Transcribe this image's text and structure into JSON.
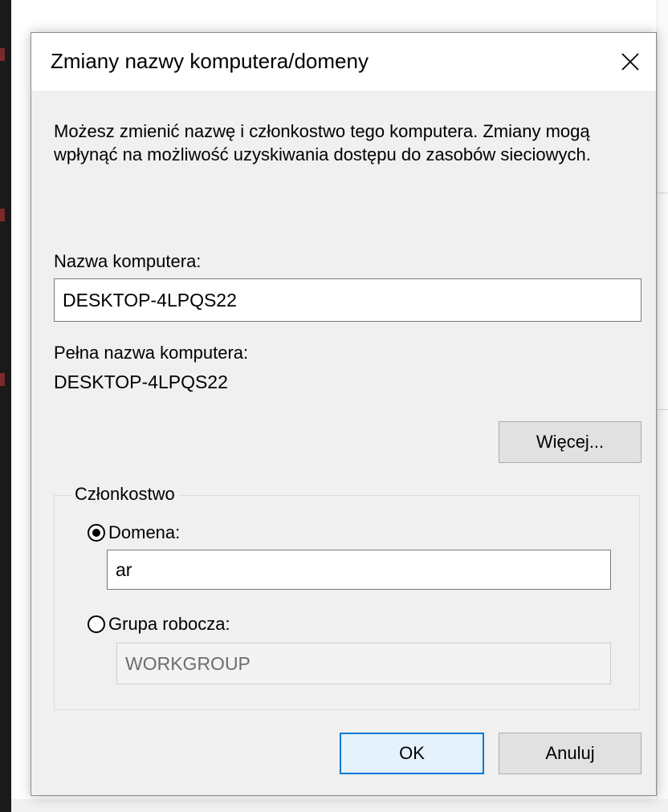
{
  "dialog": {
    "title": "Zmiany nazwy komputera/domeny",
    "description": "Możesz zmienić nazwę i członkostwo tego komputera. Zmiany mogą wpłynąć na możliwość uzyskiwania dostępu do zasobów sieciowych.",
    "computer_name_label": "Nazwa komputera:",
    "computer_name_value": "DESKTOP-4LPQS22",
    "full_name_label": "Pełna nazwa komputera:",
    "full_name_value": "DESKTOP-4LPQS22",
    "more_button": "Więcej...",
    "membership": {
      "group_label": "Członkostwo",
      "domain_label": "Domena:",
      "domain_value": "ar",
      "domain_selected": true,
      "workgroup_label": "Grupa robocza:",
      "workgroup_value": "WORKGROUP",
      "workgroup_selected": false
    },
    "ok_button": "OK",
    "cancel_button": "Anuluj"
  },
  "colors": {
    "dialog_bg": "#f0f0f0",
    "titlebar_bg": "#ffffff",
    "accent": "#0078d7"
  },
  "icons": [
    "close-icon"
  ]
}
